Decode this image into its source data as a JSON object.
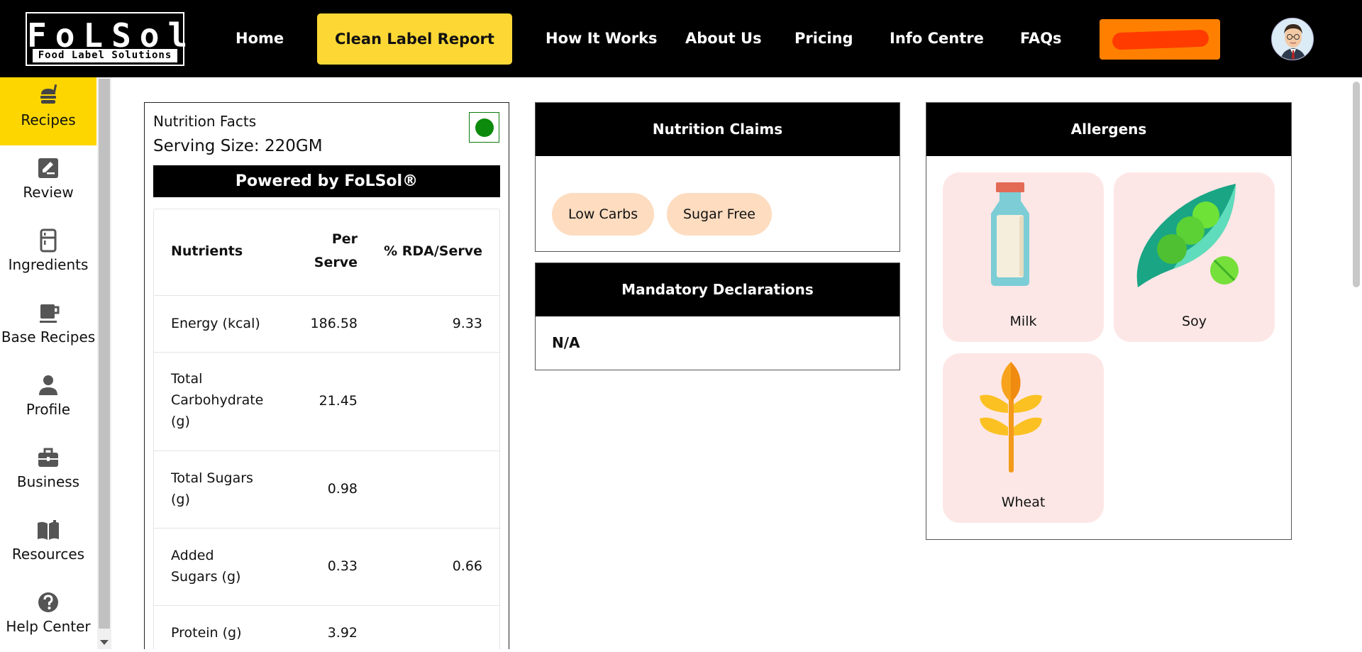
{
  "header": {
    "logo_main": "FoLSol",
    "logo_sub": "Food Label Solutions",
    "nav": {
      "home": "Home",
      "clean_label_report": "Clean Label Report",
      "how_it_works": "How It Works",
      "about_us": "About Us",
      "pricing": "Pricing",
      "info_centre": "Info Centre",
      "faqs": "FAQs"
    }
  },
  "sidebar": {
    "items": [
      {
        "label": "Recipes",
        "icon": "burger-icon",
        "active": true
      },
      {
        "label": "Review",
        "icon": "edit-icon"
      },
      {
        "label": "Ingredients",
        "icon": "fridge-icon"
      },
      {
        "label": "Base Recipes",
        "icon": "cup-icon"
      },
      {
        "label": "Profile",
        "icon": "person-icon"
      },
      {
        "label": "Business",
        "icon": "briefcase-icon"
      },
      {
        "label": "Resources",
        "icon": "book-icon"
      },
      {
        "label": "Help Center",
        "icon": "help-icon"
      }
    ]
  },
  "nutrition": {
    "title": "Nutrition Facts",
    "serving_size": "Serving Size: 220GM",
    "powered_by": "Powered by FoLSol®",
    "headers": {
      "nutrients": "Nutrients",
      "per_serve_1": "Per",
      "per_serve_2": "Serve",
      "rda": "% RDA/Serve"
    },
    "rows": [
      {
        "name": "Energy (kcal)",
        "per": "186.58",
        "rda": "9.33"
      },
      {
        "name": "Total Carbohydrate (g)",
        "per": "21.45",
        "rda": ""
      },
      {
        "name": "Total Sugars (g)",
        "per": "0.98",
        "rda": ""
      },
      {
        "name": "Added Sugars (g)",
        "per": "0.33",
        "rda": "0.66"
      },
      {
        "name": "Protein (g)",
        "per": "3.92",
        "rda": ""
      }
    ],
    "veg_color": "#0b8a0b"
  },
  "claims": {
    "title": "Nutrition Claims",
    "items": [
      "Low Carbs",
      "Sugar Free"
    ]
  },
  "declarations": {
    "title": "Mandatory Declarations",
    "value": "N/A"
  },
  "allergens": {
    "title": "Allergens",
    "items": [
      "Milk",
      "Soy",
      "Wheat"
    ]
  },
  "colors": {
    "accent_yellow": "#fdd835",
    "orange": "#ff8000",
    "pill": "#fddcc0",
    "allergen_bg": "#fde7e6"
  }
}
